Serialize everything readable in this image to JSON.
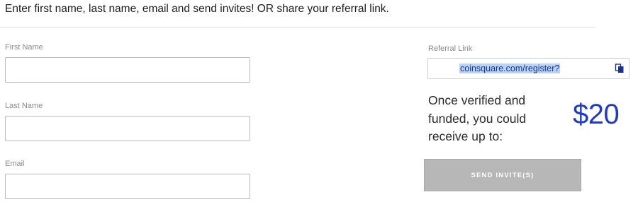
{
  "instruction": "Enter first name, last name, email and send invites! OR share your referral link.",
  "form": {
    "first_name": {
      "label": "First Name",
      "value": "",
      "placeholder": ""
    },
    "last_name": {
      "label": "Last Name",
      "value": "",
      "placeholder": ""
    },
    "email": {
      "label": "Email",
      "value": "",
      "placeholder": ""
    }
  },
  "referral": {
    "label": "Referral Link",
    "link": "coinsquare.com/register?",
    "copy_icon": "copy-icon"
  },
  "reward": {
    "text": "Once verified and funded, you could receive up to:",
    "amount": "$20",
    "amount_color": "#1e3bc8"
  },
  "send_button": {
    "label": "SEND INVITE(S)",
    "state": "disabled",
    "color": "#b7b7b7"
  }
}
